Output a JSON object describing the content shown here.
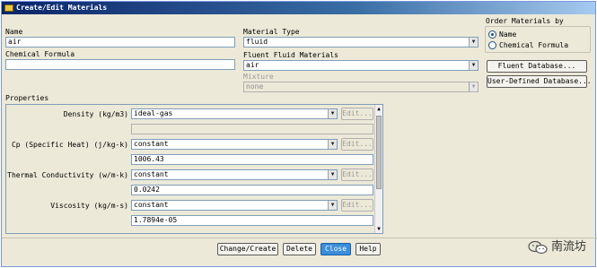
{
  "window": {
    "title": "Create/Edit Materials"
  },
  "name": {
    "label": "Name",
    "value": "air"
  },
  "chemical_formula": {
    "label": "Chemical Formula",
    "value": ""
  },
  "material_type": {
    "label": "Material Type",
    "value": "fluid"
  },
  "fluent_fluid_materials": {
    "label": "Fluent Fluid Materials",
    "value": "air"
  },
  "mixture": {
    "label": "Mixture",
    "value": "none"
  },
  "order": {
    "label": "Order Materials by",
    "options": [
      {
        "label": "Name",
        "selected": true
      },
      {
        "label": "Chemical Formula",
        "selected": false
      }
    ]
  },
  "side_buttons": {
    "fluent_database": "Fluent Database...",
    "user_defined_database": "User-Defined Database..."
  },
  "properties": {
    "label": "Properties",
    "edit_label": "Edit...",
    "items": [
      {
        "label": "Density (kg/m3)",
        "method": "ideal-gas",
        "value": ""
      },
      {
        "label": "Cp (Specific Heat) (j/kg-k)",
        "method": "constant",
        "value": "1006.43"
      },
      {
        "label": "Thermal Conductivity (w/m-k)",
        "method": "constant",
        "value": "0.0242"
      },
      {
        "label": "Viscosity (kg/m-s)",
        "method": "constant",
        "value": "1.7894e-05"
      }
    ]
  },
  "bottom_buttons": {
    "change_create": "Change/Create",
    "delete": "Delete",
    "close": "Close",
    "help": "Help"
  },
  "watermark": {
    "text": "南流坊"
  }
}
